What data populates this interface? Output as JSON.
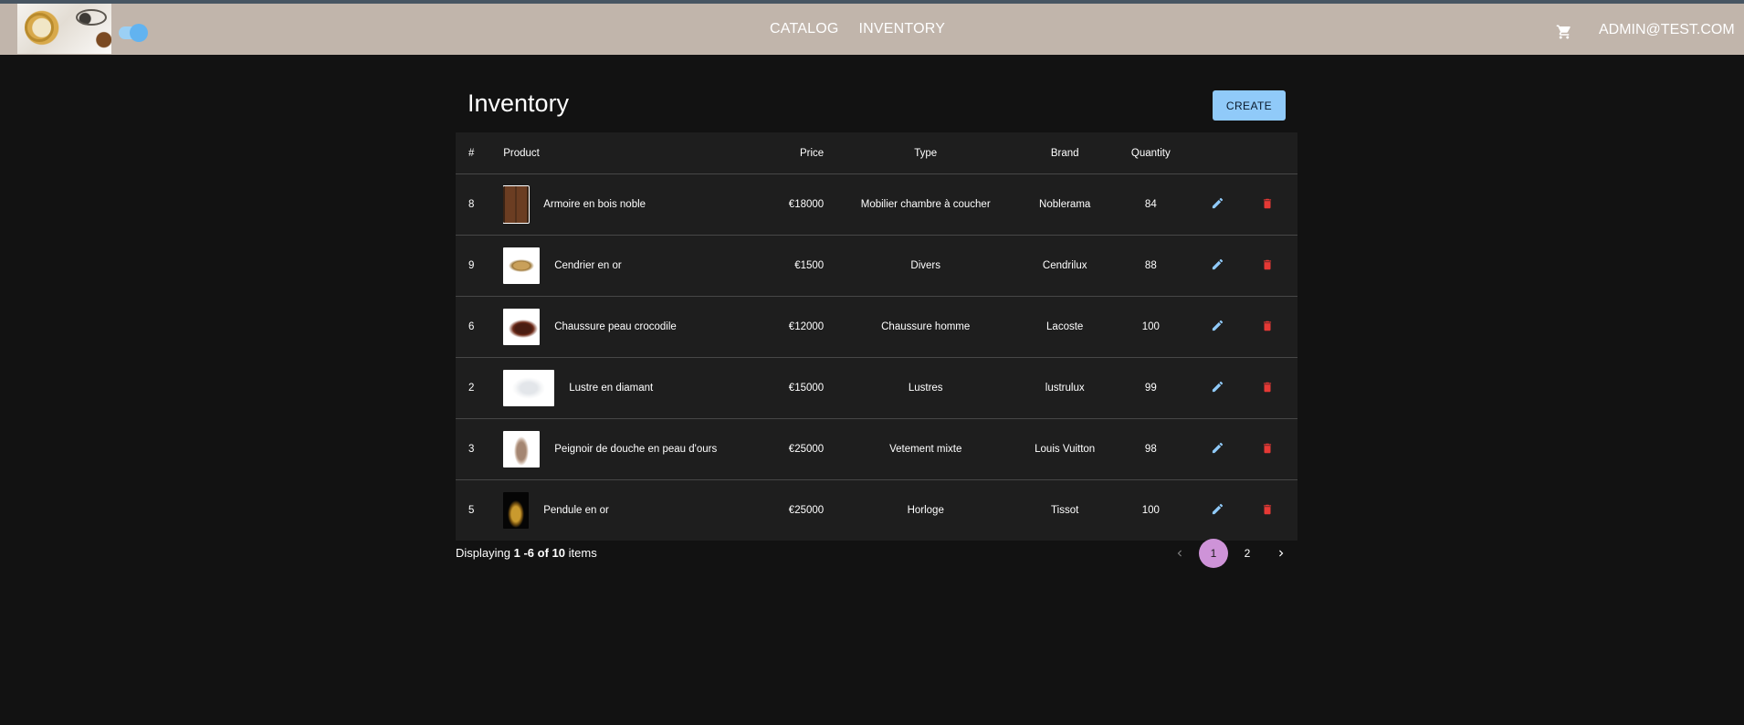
{
  "nav": {
    "links": [
      "CATALOG",
      "INVENTORY"
    ],
    "user": "ADMIN@TEST.COM",
    "cart_icon": "shopping-cart-icon"
  },
  "page": {
    "title": "Inventory",
    "create_label": "CREATE"
  },
  "table": {
    "headers": {
      "id": "#",
      "product": "Product",
      "price": "Price",
      "type": "Type",
      "brand": "Brand",
      "quantity": "Quantity"
    },
    "rows": [
      {
        "id": "8",
        "product": "Armoire en bois noble",
        "price": "€18000",
        "type": "Mobilier chambre à coucher",
        "brand": "Noblerama",
        "quantity": "84"
      },
      {
        "id": "9",
        "product": "Cendrier en or",
        "price": "€1500",
        "type": "Divers",
        "brand": "Cendrilux",
        "quantity": "88"
      },
      {
        "id": "6",
        "product": "Chaussure peau crocodile",
        "price": "€12000",
        "type": "Chaussure homme",
        "brand": "Lacoste",
        "quantity": "100"
      },
      {
        "id": "2",
        "product": "Lustre en diamant",
        "price": "€15000",
        "type": "Lustres",
        "brand": "lustrulux",
        "quantity": "99"
      },
      {
        "id": "3",
        "product": "Peignoir de douche en peau d'ours",
        "price": "€25000",
        "type": "Vetement mixte",
        "brand": "Louis Vuitton",
        "quantity": "98"
      },
      {
        "id": "5",
        "product": "Pendule en or",
        "price": "€25000",
        "type": "Horloge",
        "brand": "Tissot",
        "quantity": "100"
      }
    ]
  },
  "pagination": {
    "prefix": "Displaying",
    "range": "1 -6",
    "of": "of",
    "total": "10",
    "suffix": "items",
    "pages": [
      "1",
      "2"
    ],
    "current": "1"
  },
  "colors": {
    "topbar": "#c1b5ab",
    "background": "#121212",
    "table": "#1e1e1e",
    "create_button": "#90caf9",
    "edit_icon": "#90caf9",
    "delete_icon": "#e53935",
    "active_page": "#ce93d8"
  }
}
